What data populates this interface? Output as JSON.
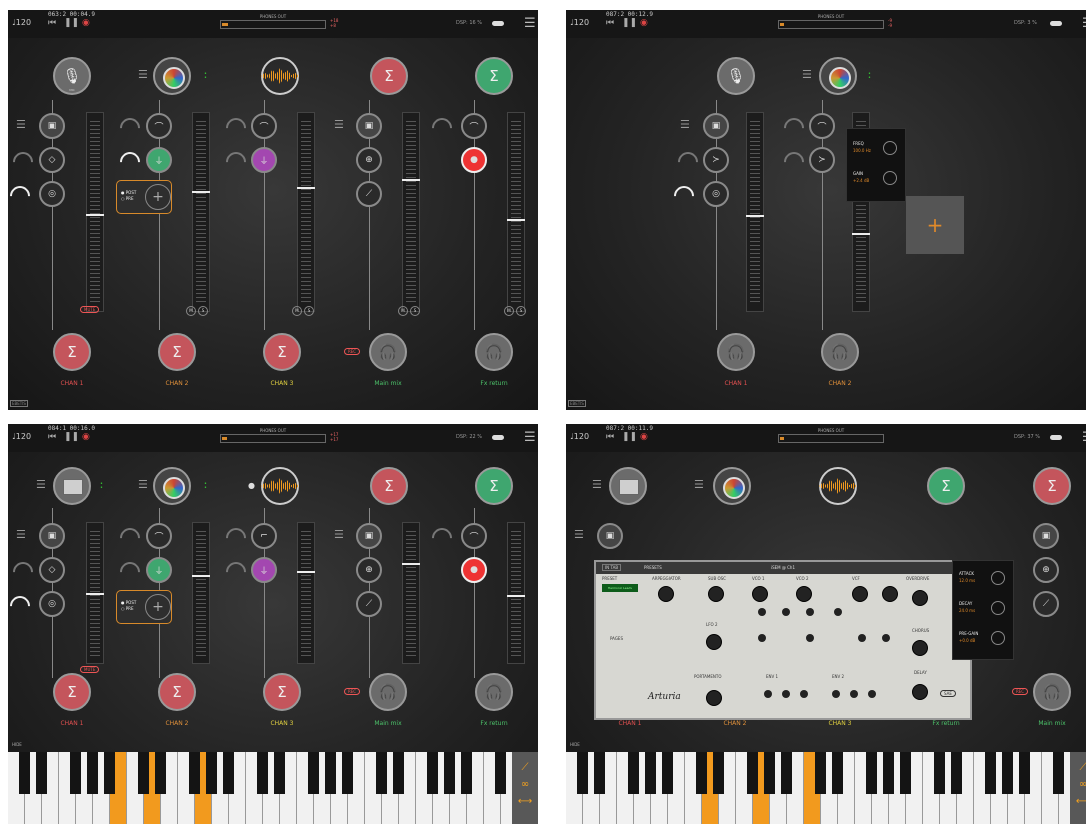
{
  "topbar": {
    "tempo": "♩120",
    "rewind_icon": "skip-back-icon",
    "pause_icon": "pause-icon",
    "record_icon": "record-icon",
    "phones_out_label": "PHONES OUT",
    "menu_icon": "hamburger-menu-icon"
  },
  "panels": [
    {
      "time": "063:2  00:04.9",
      "db_top": "+18",
      "db_bot": "+8",
      "dsp": "DSP: 16 %",
      "channels": [
        {
          "label": "CHAN 1",
          "color": "#e05050"
        },
        {
          "label": "CHAN 2",
          "color": "#e0903a"
        },
        {
          "label": "CHAN 3",
          "color": "#e0d040"
        },
        {
          "label": "Main mix",
          "color": "#4cc36a"
        },
        {
          "label": "Fx return",
          "color": "#4cc36a"
        }
      ],
      "mute_label": "MUTE",
      "rec_label": "REC",
      "post_label": "POST",
      "pre_label": "PRE",
      "mic_label": "MIC",
      "m_label": "M",
      "s_label": "S",
      "fader_levels": [
        0.57,
        0.63,
        0.63,
        0.72,
        0.52
      ],
      "tag": "EBETIS"
    },
    {
      "time": "087:2  00:12.9",
      "db_top": "-9",
      "db_bot": "-9",
      "dsp": "DSP: 3 %",
      "channels": [
        {
          "label": "CHAN 1",
          "color": "#e05050"
        },
        {
          "label": "CHAN 2",
          "color": "#e0903a"
        }
      ],
      "popup": {
        "freq_label": "FREQ",
        "freq_value": "100.0 Hz",
        "gain_label": "GAIN",
        "gain_value": "+2.4 dB"
      },
      "add_icon": "plus-icon",
      "tag": "EBETIS"
    },
    {
      "time": "084:1  00:16.0",
      "db_top": "+17",
      "db_bot": "+17",
      "dsp": "DSP: 22 %",
      "channels": [
        {
          "label": "CHAN 1",
          "color": "#e05050"
        },
        {
          "label": "CHAN 2",
          "color": "#e0903a"
        },
        {
          "label": "CHAN 3",
          "color": "#e0d040"
        },
        {
          "label": "Main mix",
          "color": "#4cc36a"
        },
        {
          "label": "Fx return",
          "color": "#4cc36a"
        }
      ],
      "mute_label": "MUTE",
      "rec_label": "REC",
      "post_label": "POST",
      "pre_label": "PRE",
      "hide_label": "HIDE",
      "fader_levels": [
        0.6,
        0.66,
        0.66,
        0.72,
        0.54
      ],
      "orange_keys": [
        6,
        8,
        11
      ]
    },
    {
      "time": "087:2  00:11.9",
      "dsp": "DSP: 37 %",
      "channels": [
        {
          "label": "CHAN 1",
          "color": "#e05050"
        },
        {
          "label": "CHAN 2",
          "color": "#e0903a"
        },
        {
          "label": "CHAN 3",
          "color": "#e0d040"
        },
        {
          "label": "Fx return",
          "color": "#4cc36a"
        },
        {
          "label": "Main mix",
          "color": "#4cc36a"
        }
      ],
      "hide_label": "HIDE",
      "rec_label": "REC",
      "isem": {
        "title": "iSEM @ Ch1",
        "back": "IN TAB",
        "presets": "PRESETS",
        "preset_section": "PRESET",
        "preset_name": "Harmonic Leadv",
        "pages": "PAGES",
        "arpeggiator": "ARPEGGIATOR",
        "sub_osc": "SUB OSC",
        "vco1": "VCO 1",
        "vco2": "VCO 2",
        "vcf": "VCF",
        "overdrive": "OVERDRIVE",
        "chorus": "CHORUS",
        "delay": "DELAY",
        "lfo2": "LFO 2",
        "env1": "ENV 1",
        "env2": "ENV 2",
        "portamento": "PORTAMENTO",
        "brand": "Arturia",
        "badge": "SAE"
      },
      "fxpop": {
        "attack_label": "ATTACK",
        "attack_value": "12.0 ms",
        "decay_label": "DECAY",
        "decay_value": "24.0 ms",
        "pregain_label": "PRE-GAIN",
        "pregain_value": "+0.0 dB"
      },
      "orange_keys": [
        8,
        11,
        14
      ]
    }
  ]
}
